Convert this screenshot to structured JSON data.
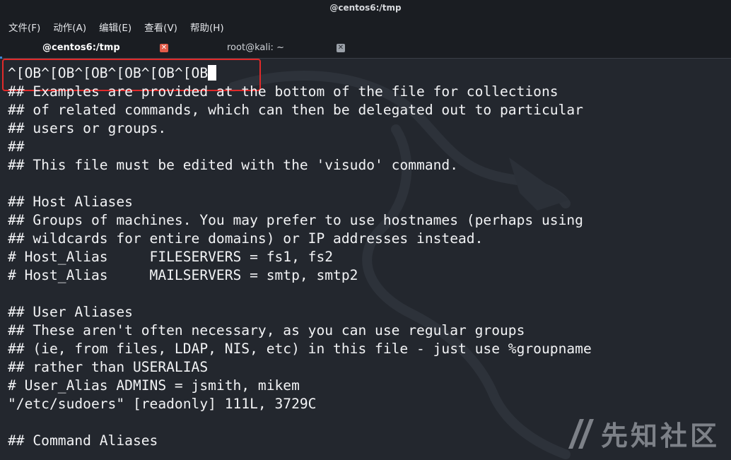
{
  "window": {
    "title": "@centos6:/tmp"
  },
  "menu": {
    "items": [
      "文件(F)",
      "动作(A)",
      "编辑(E)",
      "查看(V)",
      "帮助(H)"
    ]
  },
  "tabs": [
    {
      "label": "@centos6:/tmp",
      "active": true
    },
    {
      "label": "root@kali: ~",
      "active": false
    }
  ],
  "terminal": {
    "lines": [
      "^[OB^[OB^[OB^[OB^[OB^[OB",
      "## Examples are provided at the bottom of the file for collections",
      "## of related commands, which can then be delegated out to particular",
      "## users or groups.",
      "##",
      "## This file must be edited with the 'visudo' command.",
      "",
      "## Host Aliases",
      "## Groups of machines. You may prefer to use hostnames (perhaps using",
      "## wildcards for entire domains) or IP addresses instead.",
      "# Host_Alias     FILESERVERS = fs1, fs2",
      "# Host_Alias     MAILSERVERS = smtp, smtp2",
      "",
      "## User Aliases",
      "## These aren't often necessary, as you can use regular groups",
      "## (ie, from files, LDAP, NIS, etc) in this file - just use %groupname",
      "## rather than USERALIAS",
      "# User_Alias ADMINS = jsmith, mikem",
      "\"/etc/sudoers\" [readonly] 111L, 3729C",
      "",
      "## Command Aliases"
    ]
  },
  "watermark": {
    "text": "先知社区"
  },
  "colors": {
    "highlight": "#e02a2a",
    "terminal_bg": "#23272e",
    "text": "#f2f3f5"
  }
}
